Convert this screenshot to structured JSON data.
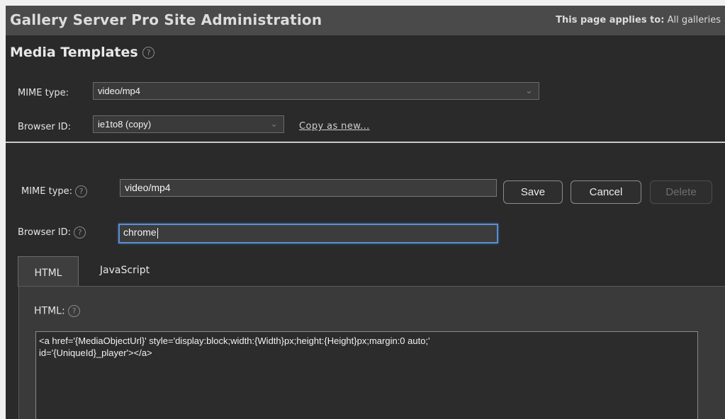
{
  "header": {
    "title": "Gallery Server Pro Site Administration",
    "scope_label": "This page applies to:",
    "scope_value": "All galleries"
  },
  "page": {
    "title": "Media Templates"
  },
  "selector": {
    "mime_label": "MIME type:",
    "mime_value": "video/mp4",
    "browser_label": "Browser ID:",
    "browser_value": "ie1to8 (copy)",
    "copy_link": "Copy as new..."
  },
  "editor": {
    "mime_label": "MIME type:",
    "mime_value": "video/mp4",
    "browser_label": "Browser ID:",
    "browser_value": "chrome",
    "buttons": {
      "save": "Save",
      "cancel": "Cancel",
      "delete": "Delete"
    },
    "tabs": [
      "HTML",
      "JavaScript"
    ],
    "html_label": "HTML:",
    "html_value": "<a href='{MediaObjectUrl}' style='display:block;width:{Width}px;height:{Height}px;margin:0 auto;'\nid='{UniqueId}_player'></a>"
  },
  "icons": {
    "help": "help-circle-icon",
    "dropdown": "chevron-down-icon"
  },
  "colors": {
    "header_bg": "#4a4a4a",
    "body_bg": "#2a2a2a",
    "focus": "#5b8fd0"
  }
}
